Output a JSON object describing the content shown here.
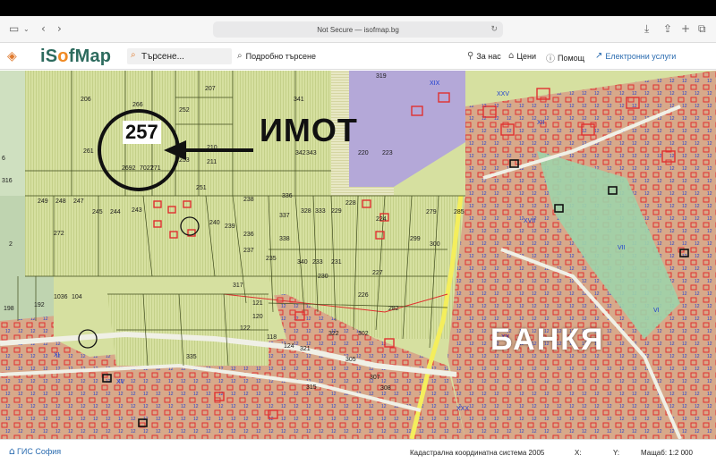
{
  "browser": {
    "address": "Not Secure — isofmap.bg"
  },
  "header": {
    "logo_prefix": "iS",
    "logo_o": "o",
    "logo_suffix": "fMap",
    "search_value": "Търсене...",
    "advanced_search": "Подробно търсене",
    "about": "За нас",
    "prices": "Цени",
    "help": "Помощ",
    "e_services": "Електронни услуги"
  },
  "map": {
    "plot_label": "257",
    "annotation_property": "ИМОТ",
    "annotation_district": "БАНКЯ",
    "parcels": [
      "206",
      "266",
      "252",
      "207",
      "341",
      "319",
      "261",
      "253",
      "210",
      "342",
      "343",
      "220",
      "223",
      "211",
      "2692",
      "7027",
      "271",
      "251",
      "238",
      "336",
      "249",
      "248",
      "247",
      "245",
      "244",
      "243",
      "240",
      "239",
      "337",
      "328",
      "333",
      "229",
      "228",
      "279",
      "285",
      "286",
      "272",
      "236",
      "338",
      "224",
      "299",
      "300",
      "237",
      "235",
      "340",
      "233",
      "231",
      "230",
      "227",
      "226",
      "282",
      "198",
      "192",
      "1036",
      "104",
      "121",
      "120",
      "122",
      "118",
      "124",
      "321",
      "322",
      "302",
      "305",
      "307",
      "308",
      "315",
      "317",
      "335",
      "2"
    ]
  },
  "footer": {
    "gis_label": "ГИС София",
    "coord_system": "Кадастрална координатна система 2005",
    "x_label": "X:",
    "y_label": "Y:",
    "scale": "Мащаб: 1:2 000"
  },
  "colors": {
    "brand_green": "#2d6b5e",
    "brand_orange": "#f08a24",
    "parcel_fill": "#d6e0a0",
    "parcel_line": "#3e4a1c",
    "building_red": "#e03030",
    "label_blue": "#2040d0",
    "road_yellow": "#f4ee5c",
    "purple_zone": "#b4a8d8"
  }
}
